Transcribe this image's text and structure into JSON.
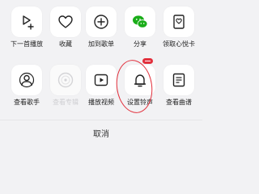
{
  "row1": [
    {
      "label": "下一首播放",
      "icon": "play-next-icon"
    },
    {
      "label": "收藏",
      "icon": "heart-icon"
    },
    {
      "label": "加到歌单",
      "icon": "add-circle-icon"
    },
    {
      "label": "分享",
      "icon": "wechat-icon"
    },
    {
      "label": "领取心悦卡",
      "icon": "gift-card-icon"
    }
  ],
  "row2": [
    {
      "label": "查看歌手",
      "icon": "person-icon"
    },
    {
      "label": "查看专辑",
      "icon": "album-disc-icon",
      "disabled": true
    },
    {
      "label": "播放视频",
      "icon": "video-play-icon"
    },
    {
      "label": "设置铃声",
      "icon": "bell-icon"
    },
    {
      "label": "查看曲谱",
      "icon": "music-score-icon"
    }
  ],
  "cancel_label": "取消",
  "colors": {
    "background": "#f2f2f4",
    "tile": "#ffffff",
    "highlight": "#e2303c",
    "wechat": "#1aad19"
  }
}
